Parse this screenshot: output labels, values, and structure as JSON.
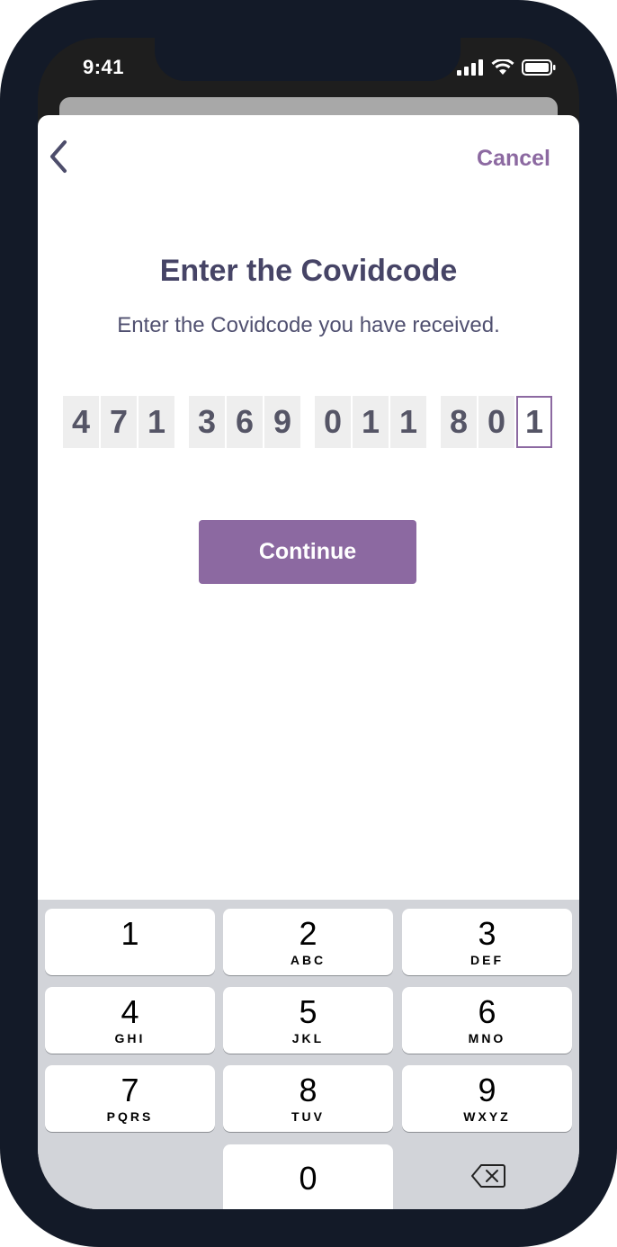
{
  "status_bar": {
    "time": "9:41"
  },
  "header": {
    "cancel_label": "Cancel"
  },
  "main": {
    "title": "Enter the Covidcode",
    "subtitle": "Enter the Covidcode you have received.",
    "code_digits": [
      "4",
      "7",
      "1",
      "3",
      "6",
      "9",
      "0",
      "1",
      "1",
      "8",
      "0",
      "1"
    ],
    "continue_label": "Continue"
  },
  "keypad": {
    "keys": [
      {
        "num": "1",
        "letters": ""
      },
      {
        "num": "2",
        "letters": "ABC"
      },
      {
        "num": "3",
        "letters": "DEF"
      },
      {
        "num": "4",
        "letters": "GHI"
      },
      {
        "num": "5",
        "letters": "JKL"
      },
      {
        "num": "6",
        "letters": "MNO"
      },
      {
        "num": "7",
        "letters": "PQRS"
      },
      {
        "num": "8",
        "letters": "TUV"
      },
      {
        "num": "9",
        "letters": "WXYZ"
      },
      {
        "num": "0",
        "letters": ""
      }
    ]
  },
  "colors": {
    "accent": "#8c69a1",
    "title": "#464466",
    "frame": "#131a28"
  }
}
